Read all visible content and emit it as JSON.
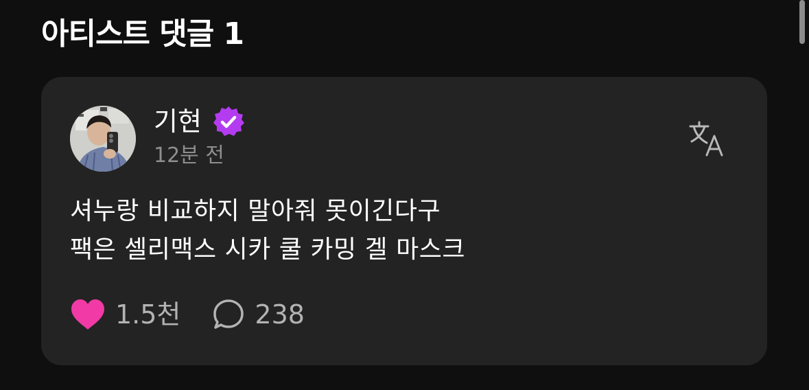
{
  "section": {
    "title": "아티스트 댓글 1"
  },
  "comment": {
    "author": "기현",
    "verified_icon": "verified-badge-icon",
    "time": "12분 전",
    "translate_icon": "translate-icon",
    "lines": [
      "셔누랑 비교하지 말아줘 못이긴다구",
      "팩은 셀리맥스 시카 쿨 카밍 겔 마스크"
    ],
    "likes": "1.5천",
    "comments": "238"
  },
  "colors": {
    "background": "#0f0f0f",
    "card": "#232323",
    "heart": "#f13aa5",
    "badge": "#b43cf0",
    "muted": "#8e8e8e"
  }
}
